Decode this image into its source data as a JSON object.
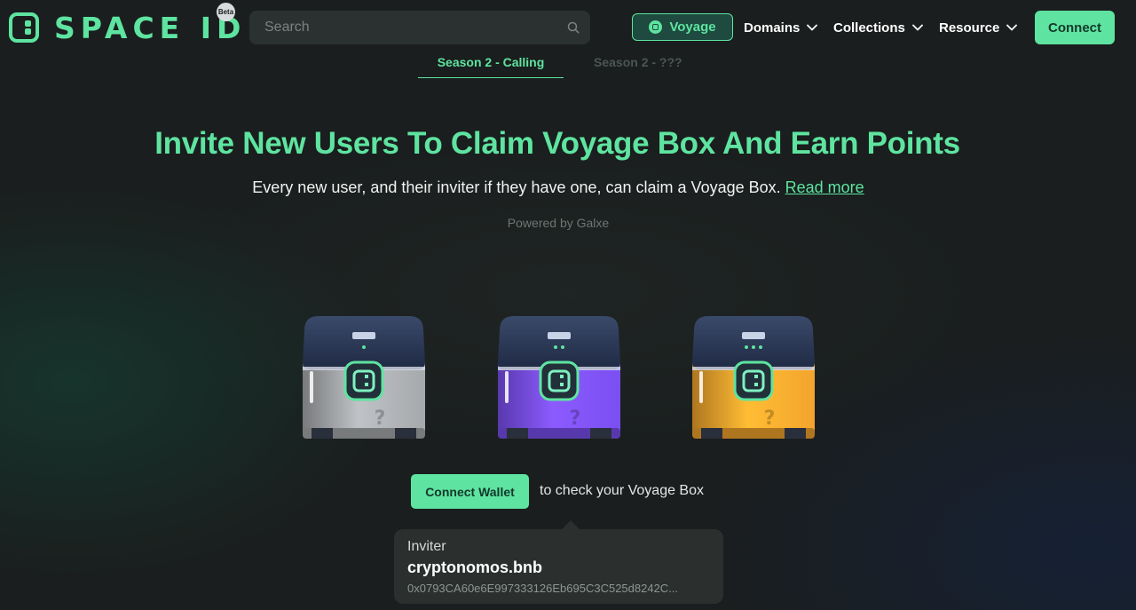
{
  "header": {
    "logo_text": "SPACE ID",
    "beta_badge": "Beta",
    "search": {
      "placeholder": "Search",
      "value": ""
    },
    "voyage_label": "Voyage",
    "nav": [
      {
        "label": "Domains"
      },
      {
        "label": "Collections"
      },
      {
        "label": "Resource"
      }
    ],
    "connect_label": "Connect"
  },
  "tabs": [
    {
      "label": "Season 2 - Calling",
      "active": true
    },
    {
      "label": "Season 2 - ???",
      "active": false
    }
  ],
  "hero": {
    "title": "Invite New Users To Claim Voyage Box And Earn Points",
    "subtitle": "Every new user, and their inviter if they have one, can claim a Voyage Box.",
    "read_more": "Read more",
    "powered_by": "Powered by Galxe"
  },
  "boxes": [
    {
      "tier": "gray",
      "stars": 1,
      "color": "#a6a9ac"
    },
    {
      "tier": "purple",
      "stars": 2,
      "color": "#7a4ff0"
    },
    {
      "tier": "orange",
      "stars": 3,
      "color": "#f3a42d"
    }
  ],
  "wallet": {
    "button_label": "Connect Wallet",
    "hint": "to check your Voyage Box"
  },
  "inviter": {
    "label": "Inviter",
    "name": "cryptonomos.bnb",
    "address": "0x0793CA60e6E997333126Eb695C3C525d8242C..."
  },
  "colors": {
    "accent": "#5ee4a0",
    "background": "#1a1e1e",
    "card": "#2b302f"
  }
}
